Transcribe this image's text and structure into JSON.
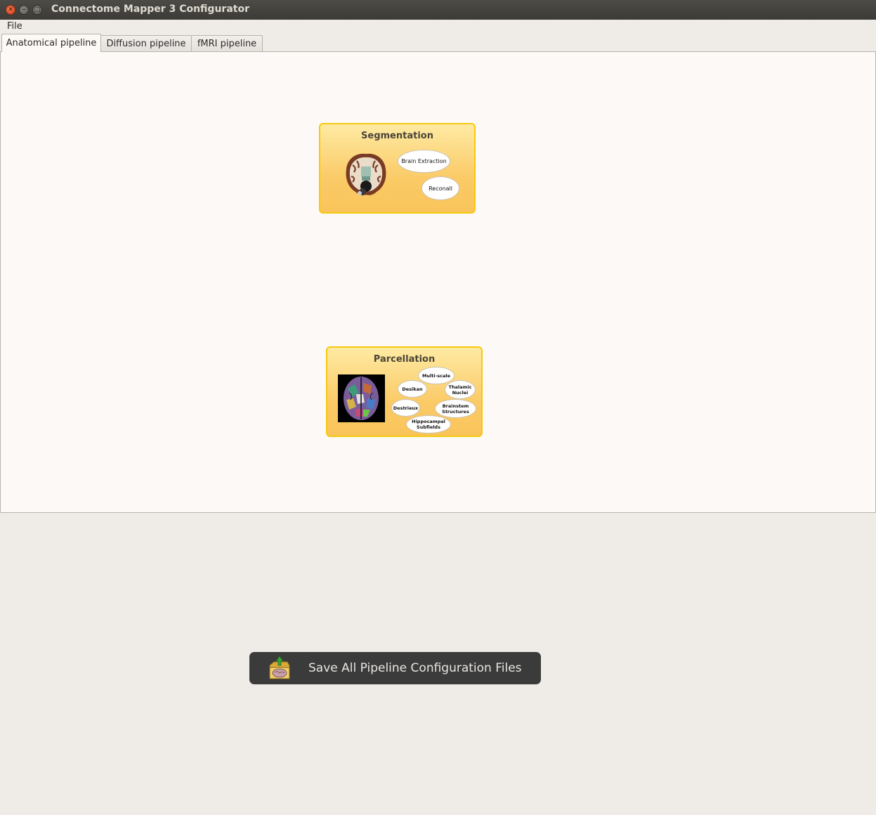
{
  "window": {
    "title": "Connectome Mapper 3 Configurator"
  },
  "menubar": {
    "file_label": "File"
  },
  "tabs": [
    {
      "label": "Anatomical pipeline",
      "active": true
    },
    {
      "label": "Diffusion pipeline",
      "active": false
    },
    {
      "label": "fMRI pipeline",
      "active": false
    }
  ],
  "segmentation": {
    "title": "Segmentation",
    "ovals": [
      "Brain Extraction",
      "Reconall"
    ]
  },
  "parcellation": {
    "title": "Parcellation",
    "ovals": [
      "Multi-scale",
      "Desikan",
      "Thalamic Nuclei",
      "Destrieux",
      "Brainstem Structures",
      "Hippocampal Subfields"
    ]
  },
  "save_button": {
    "label": "Save All Pipeline Configuration Files"
  },
  "colors": {
    "stage_border": "#f6c90e",
    "stage_fill": "#fbcb68",
    "pane_bg": "#fcf9f6",
    "window_bg": "#efebe7",
    "save_button_bg": "#3b3b3b"
  }
}
